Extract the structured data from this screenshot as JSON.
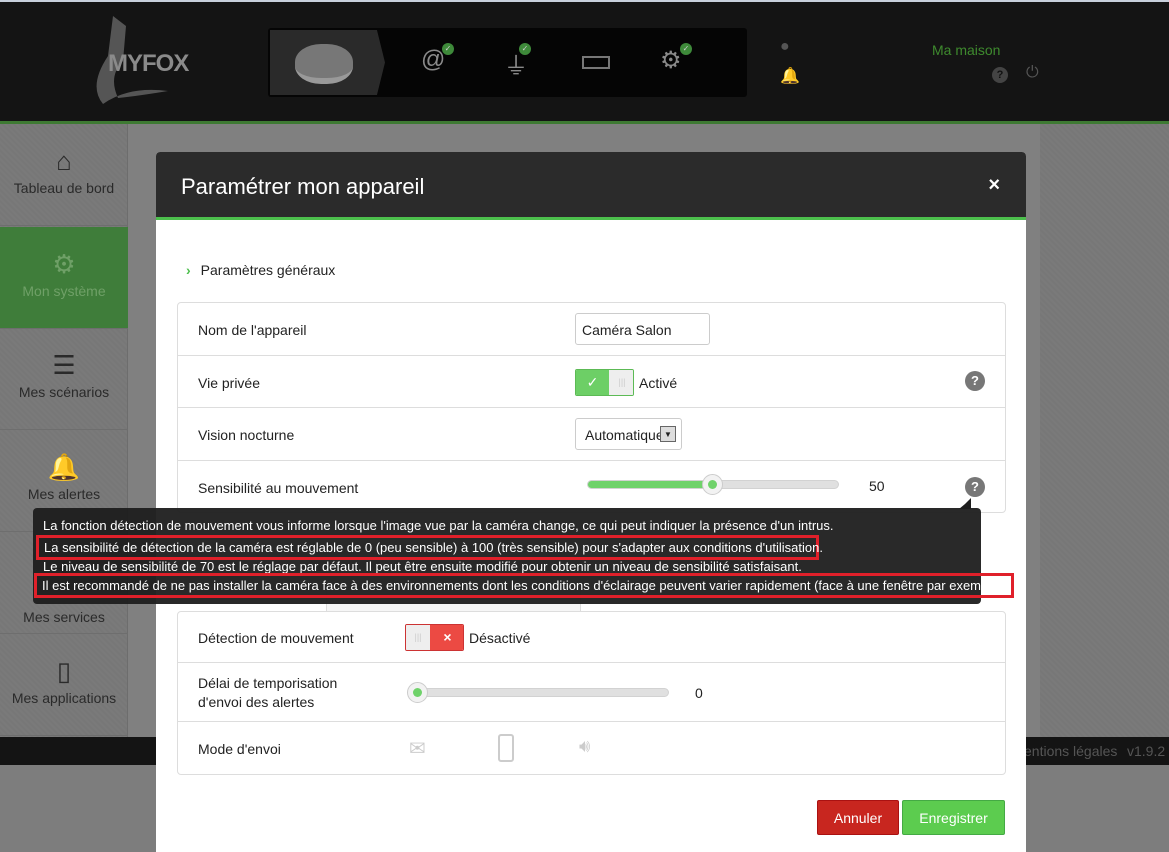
{
  "header": {
    "logo": "MYFOX",
    "home_name": "Ma maison",
    "status_icons": [
      "device-icon",
      "internet-icon",
      "power-plug-icon",
      "battery-icon",
      "settings-icon"
    ],
    "accent": "#4cbf4c"
  },
  "sidebar": {
    "items": [
      {
        "label": "Tableau de bord",
        "icon": "home-icon"
      },
      {
        "label": "Mon système",
        "icon": "gears-icon",
        "active": true
      },
      {
        "label": "Mes scénarios",
        "icon": "scenarios-icon"
      },
      {
        "label": "Mes alertes",
        "icon": "bell-icon"
      },
      {
        "label": "Mes services",
        "icon": "services-icon"
      },
      {
        "label": "Mes applications",
        "icon": "phone-icon"
      }
    ]
  },
  "footer": {
    "legal": "entions légales",
    "version": "v1.9.2"
  },
  "modal": {
    "title": "Paramétrer mon appareil",
    "close": "×",
    "section": "Paramètres généraux",
    "rows": {
      "name": {
        "label": "Nom de l'appareil",
        "value": "Caméra Salon"
      },
      "privacy": {
        "label": "Vie privée",
        "state": "Activé",
        "on": true
      },
      "night": {
        "label": "Vision nocturne",
        "value": "Automatique"
      },
      "sensitivity": {
        "label": "Sensibilité au mouvement",
        "value": "50",
        "min": 0,
        "max": 100
      },
      "motion": {
        "label": "Détection de mouvement",
        "state": "Désactivé",
        "on": false
      },
      "delay": {
        "label1": "Délai de temporisation",
        "label2": "d'envoi des alertes",
        "value": "0"
      },
      "mode": {
        "label": "Mode d'envoi",
        "icons": [
          "mail-icon",
          "mobile-icon",
          "siren-icon"
        ]
      }
    },
    "cancel": "Annuler",
    "save": "Enregistrer"
  },
  "tooltip": {
    "lines": [
      "La fonction détection de mouvement vous informe lorsque l'image vue par la caméra change, ce qui peut indiquer la présence d'un intrus.",
      "La sensibilité de détection de la caméra est réglable de 0 (peu sensible) à 100 (très sensible) pour s'adapter aux conditions d'utilisation.",
      "Le niveau de sensibilité de 70 est le réglage par défaut. Il peut être ensuite modifié pour obtenir un niveau de sensibilité satisfaisant.",
      "Il est recommandé de ne pas installer la caméra face à des environnements dont les conditions d'éclairage peuvent varier rapidement (face à une fenêtre par exemple)."
    ]
  }
}
